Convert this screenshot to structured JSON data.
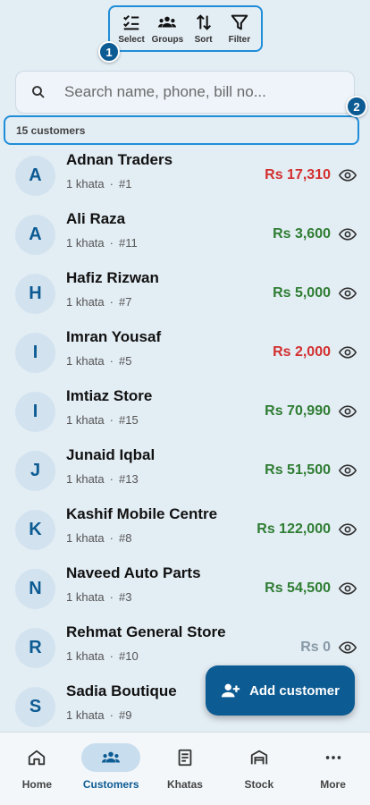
{
  "toolbar": {
    "items": [
      {
        "label": "Select",
        "icon": "checklist-icon"
      },
      {
        "label": "Groups",
        "icon": "groups-icon"
      },
      {
        "label": "Sort",
        "icon": "sort-icon"
      },
      {
        "label": "Filter",
        "icon": "filter-icon"
      }
    ],
    "marker": "1"
  },
  "search": {
    "placeholder": "Search name, phone, bill no...",
    "value": ""
  },
  "count": {
    "label": "15 customers",
    "marker": "2"
  },
  "customers": [
    {
      "initial": "A",
      "name": "Adnan Traders",
      "khata": "1 khata",
      "number": "#1",
      "amount": "Rs 17,310",
      "status": "red"
    },
    {
      "initial": "A",
      "name": "Ali Raza",
      "khata": "1 khata",
      "number": "#11",
      "amount": "Rs 3,600",
      "status": "green"
    },
    {
      "initial": "H",
      "name": "Hafiz Rizwan",
      "khata": "1 khata",
      "number": "#7",
      "amount": "Rs 5,000",
      "status": "green"
    },
    {
      "initial": "I",
      "name": "Imran Yousaf",
      "khata": "1 khata",
      "number": "#5",
      "amount": "Rs 2,000",
      "status": "red"
    },
    {
      "initial": "I",
      "name": "Imtiaz Store",
      "khata": "1 khata",
      "number": "#15",
      "amount": "Rs 70,990",
      "status": "green"
    },
    {
      "initial": "J",
      "name": "Junaid Iqbal",
      "khata": "1 khata",
      "number": "#13",
      "amount": "Rs 51,500",
      "status": "green"
    },
    {
      "initial": "K",
      "name": "Kashif Mobile Centre",
      "khata": "1 khata",
      "number": "#8",
      "amount": "Rs 122,000",
      "status": "green"
    },
    {
      "initial": "N",
      "name": "Naveed Auto Parts",
      "khata": "1 khata",
      "number": "#3",
      "amount": "Rs 54,500",
      "status": "green"
    },
    {
      "initial": "R",
      "name": "Rehmat General Store",
      "khata": "1 khata",
      "number": "#10",
      "amount": "Rs 0",
      "status": "grey"
    },
    {
      "initial": "S",
      "name": "Sadia Boutique",
      "khata": "1 khata",
      "number": "#9",
      "amount": "",
      "status": "green"
    }
  ],
  "fab": {
    "label": "Add customer",
    "icon": "add-person-icon"
  },
  "bottom_nav": [
    {
      "label": "Home",
      "icon": "home-icon",
      "active": false
    },
    {
      "label": "Customers",
      "icon": "customers-icon",
      "active": true
    },
    {
      "label": "Khatas",
      "icon": "ledger-icon",
      "active": false
    },
    {
      "label": "Stock",
      "icon": "warehouse-icon",
      "active": false
    },
    {
      "label": "More",
      "icon": "more-icon",
      "active": false
    }
  ],
  "colors": {
    "primary": "#0d5b93",
    "highlight": "#1f8ed8",
    "positive": "#2e7d32",
    "negative": "#d32f2f",
    "zero": "#8899a6"
  }
}
